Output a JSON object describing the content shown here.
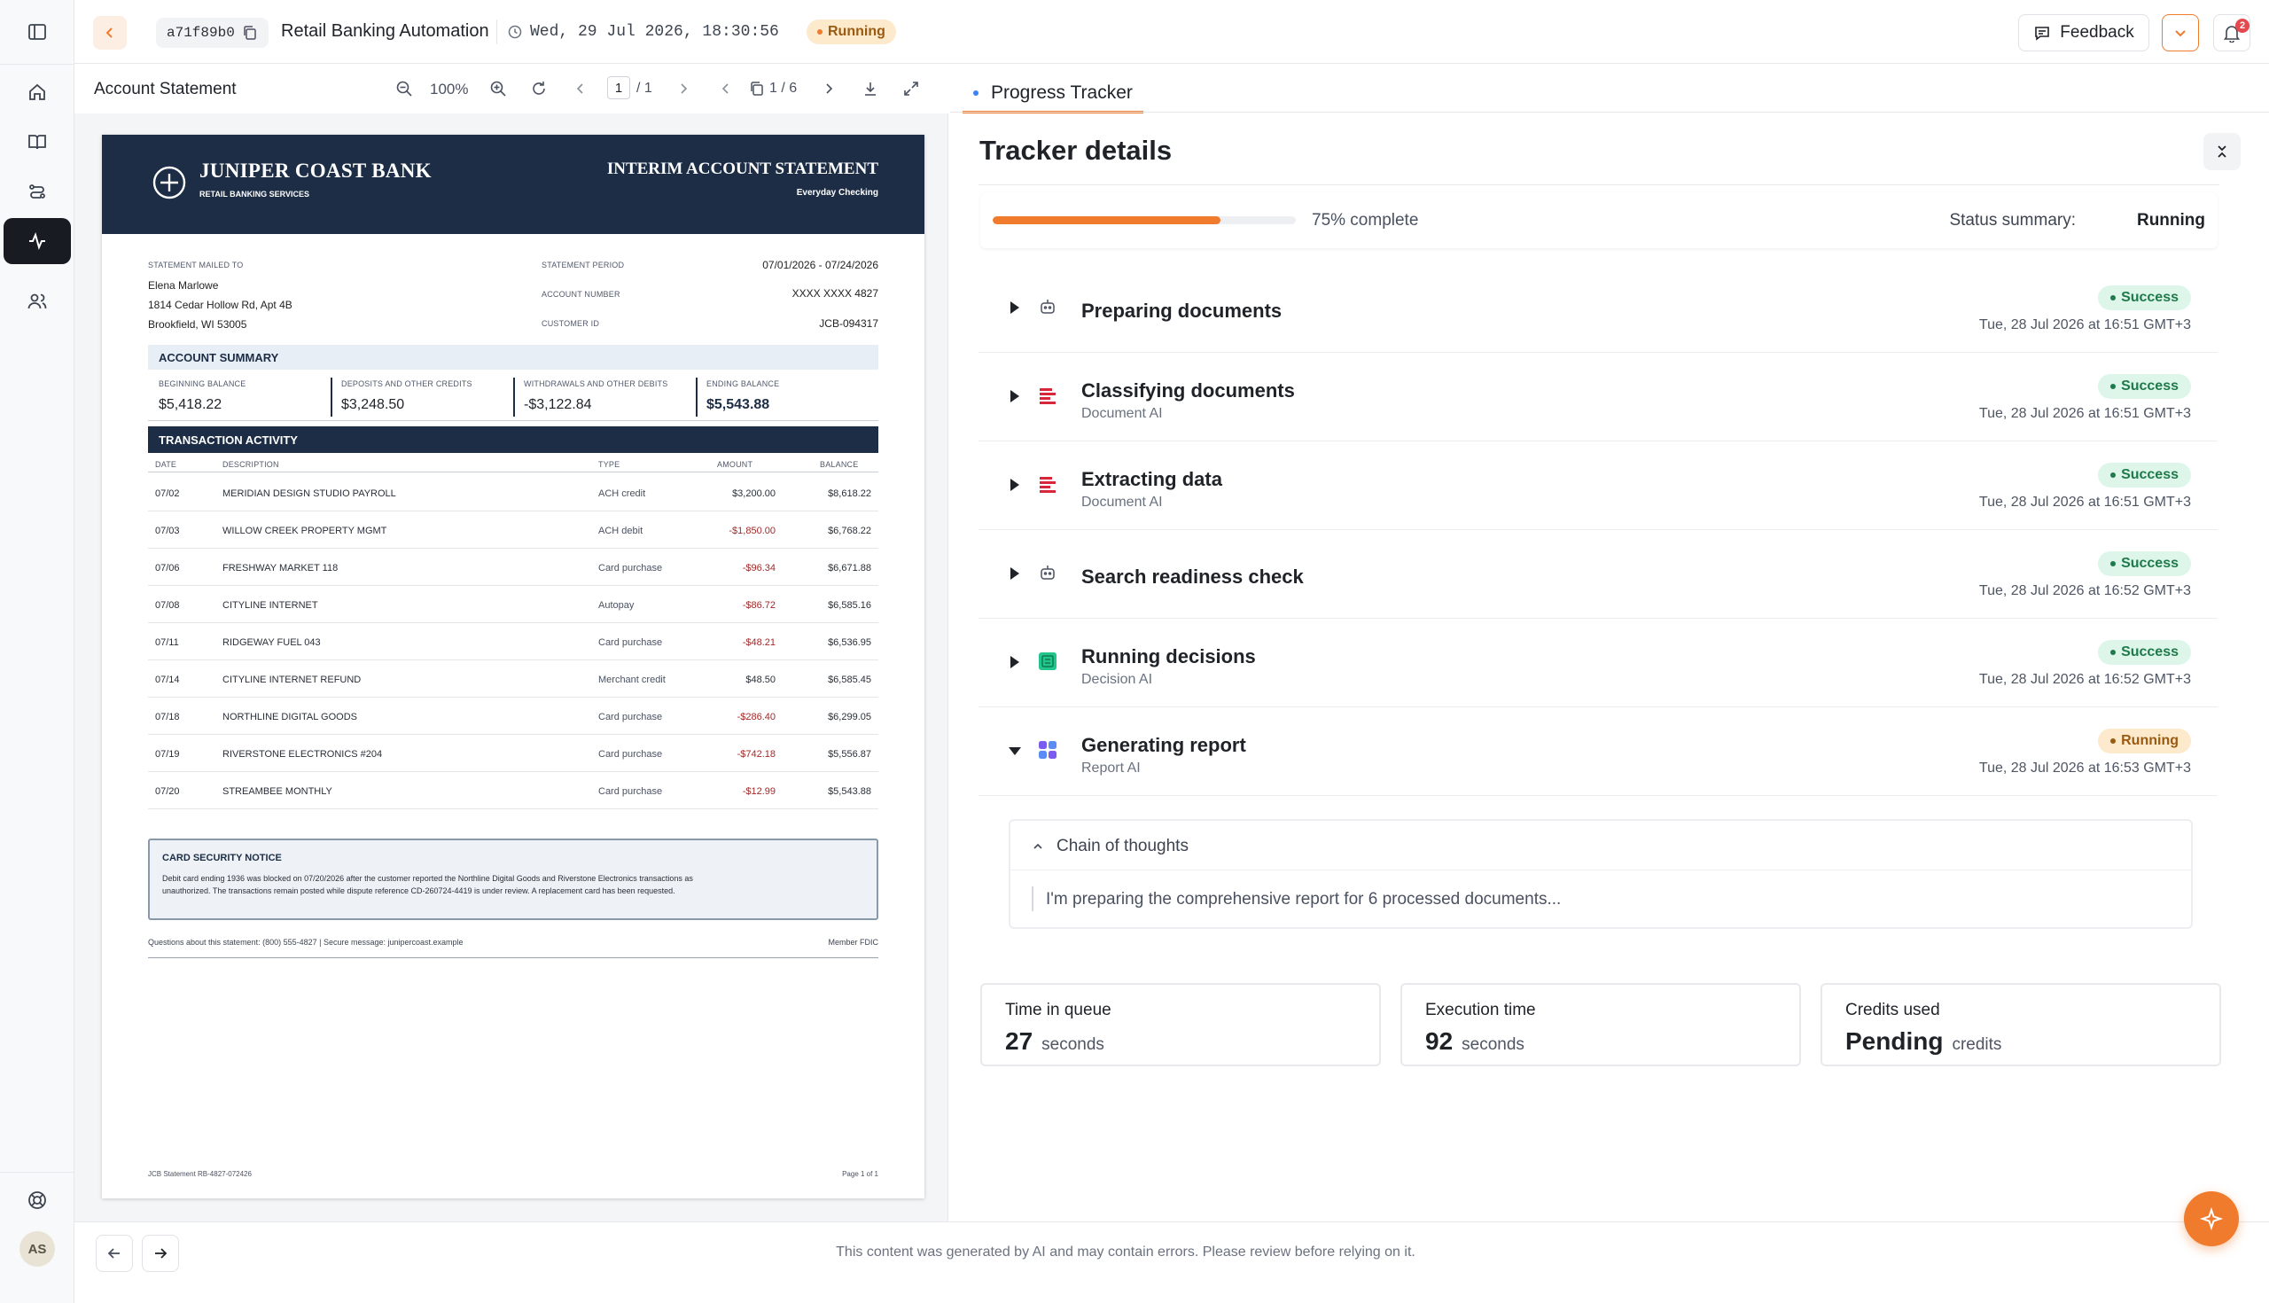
{
  "header": {
    "run_id": "a71f89b0",
    "workflow_name": "Retail Banking Automation",
    "timestamp": "Wed, 29 Jul 2026, 18:30:56",
    "status": "Running",
    "feedback_label": "Feedback",
    "notification_count": "2"
  },
  "viewer": {
    "title": "Account Statement",
    "zoom": "100%",
    "page_current": "1",
    "page_total": "/ 1",
    "doc_position": "1 / 6"
  },
  "statement": {
    "bank_name": "JUNIPER COAST BANK",
    "bank_sub": "RETAIL BANKING SERVICES",
    "doc_title": "INTERIM ACCOUNT STATEMENT",
    "doc_sub": "Everyday Checking",
    "mailed_to_label": "STATEMENT MAILED TO",
    "customer_name": "Elena Marlowe",
    "address_line1": "1814 Cedar Hollow Rd, Apt 4B",
    "address_line2": "Brookfield, WI 53005",
    "period_label": "STATEMENT PERIOD",
    "period_value": "07/01/2026 - 07/24/2026",
    "account_label": "ACCOUNT NUMBER",
    "account_value": "XXXX XXXX 4827",
    "customer_id_label": "CUSTOMER ID",
    "customer_id_value": "JCB-094317",
    "summary_title": "ACCOUNT SUMMARY",
    "summary": [
      {
        "label": "BEGINNING BALANCE",
        "value": "$5,418.22"
      },
      {
        "label": "DEPOSITS AND OTHER CREDITS",
        "value": "$3,248.50"
      },
      {
        "label": "WITHDRAWALS AND OTHER DEBITS",
        "value": "-$3,122.84"
      },
      {
        "label": "ENDING BALANCE",
        "value": "$5,543.88"
      }
    ],
    "activity_title": "TRANSACTION ACTIVITY",
    "columns": [
      "DATE",
      "DESCRIPTION",
      "TYPE",
      "AMOUNT",
      "BALANCE"
    ],
    "transactions": [
      {
        "date": "07/02",
        "desc": "MERIDIAN DESIGN STUDIO PAYROLL",
        "type": "ACH credit",
        "amount": "$3,200.00",
        "balance": "$8,618.22"
      },
      {
        "date": "07/03",
        "desc": "WILLOW CREEK PROPERTY MGMT",
        "type": "ACH debit",
        "amount": "-$1,850.00",
        "balance": "$6,768.22"
      },
      {
        "date": "07/06",
        "desc": "FRESHWAY MARKET 118",
        "type": "Card purchase",
        "amount": "-$96.34",
        "balance": "$6,671.88"
      },
      {
        "date": "07/08",
        "desc": "CITYLINE INTERNET",
        "type": "Autopay",
        "amount": "-$86.72",
        "balance": "$6,585.16"
      },
      {
        "date": "07/11",
        "desc": "RIDGEWAY FUEL 043",
        "type": "Card purchase",
        "amount": "-$48.21",
        "balance": "$6,536.95"
      },
      {
        "date": "07/14",
        "desc": "CITYLINE INTERNET REFUND",
        "type": "Merchant credit",
        "amount": "$48.50",
        "balance": "$6,585.45"
      },
      {
        "date": "07/18",
        "desc": "NORTHLINE DIGITAL GOODS",
        "type": "Card purchase",
        "amount": "-$286.40",
        "balance": "$6,299.05"
      },
      {
        "date": "07/19",
        "desc": "RIVERSTONE ELECTRONICS #204",
        "type": "Card purchase",
        "amount": "-$742.18",
        "balance": "$5,556.87"
      },
      {
        "date": "07/20",
        "desc": "STREAMBEE MONTHLY",
        "type": "Card purchase",
        "amount": "-$12.99",
        "balance": "$5,543.88"
      }
    ],
    "notice_title": "CARD SECURITY NOTICE",
    "notice_line1": "Debit card ending 1936 was blocked on 07/20/2026 after the customer reported the Northline Digital Goods and Riverstone Electronics transactions as",
    "notice_line2": "unauthorized. The transactions remain posted while dispute reference CD-260724-4419 is under review. A replacement card has been requested.",
    "contact": "Questions about this statement: (800) 555-4827  |  Secure message: junipercoast.example",
    "fdic": "Member FDIC",
    "footer_ref": "JCB Statement RB-4827-072426",
    "footer_page": "Page 1 of 1"
  },
  "tracker": {
    "tab_label": "Progress Tracker",
    "title": "Tracker details",
    "progress_label": "75% complete",
    "progress_fraction": 0.75,
    "status_summary_label": "Status summary:",
    "status_summary_value": "Running",
    "steps": [
      {
        "title": "Preparing documents",
        "sub": "",
        "status": "Success",
        "time": "Tue, 28 Jul 2026 at 16:51 GMT+3"
      },
      {
        "title": "Classifying documents",
        "sub": "Document AI",
        "status": "Success",
        "time": "Tue, 28 Jul 2026 at 16:51 GMT+3"
      },
      {
        "title": "Extracting data",
        "sub": "Document AI",
        "status": "Success",
        "time": "Tue, 28 Jul 2026 at 16:51 GMT+3"
      },
      {
        "title": "Search readiness check",
        "sub": "",
        "status": "Success",
        "time": "Tue, 28 Jul 2026 at 16:52 GMT+3"
      },
      {
        "title": "Running decisions",
        "sub": "Decision AI",
        "status": "Success",
        "time": "Tue, 28 Jul 2026 at 16:52 GMT+3"
      },
      {
        "title": "Generating report",
        "sub": "Report AI",
        "status": "Running",
        "time": "Tue, 28 Jul 2026 at 16:53 GMT+3"
      }
    ],
    "chain_title": "Chain of thoughts",
    "chain_text": "I'm preparing the comprehensive report for 6 processed documents...",
    "stats": [
      {
        "label": "Time in queue",
        "value": "27",
        "unit": "seconds"
      },
      {
        "label": "Execution time",
        "value": "92",
        "unit": "seconds"
      },
      {
        "label": "Credits used",
        "value": "Pending",
        "unit": "credits"
      }
    ]
  },
  "footer": {
    "disclaimer": "This content was generated by AI and may contain errors. Please review before relying on it.",
    "user_initials": "AS"
  },
  "colors": {
    "accent": "#f07b2d",
    "dark": "#181b21",
    "statement_band": "#1c2d45",
    "success_bg": "#ddf6e9",
    "success_fg": "#1f7a4b",
    "running_bg": "#fde9cc",
    "running_fg": "#9a5a10",
    "doc_ai_red": "#d8263a",
    "decision_green": "#22c58b",
    "report_purple": "#7a5cf0"
  }
}
